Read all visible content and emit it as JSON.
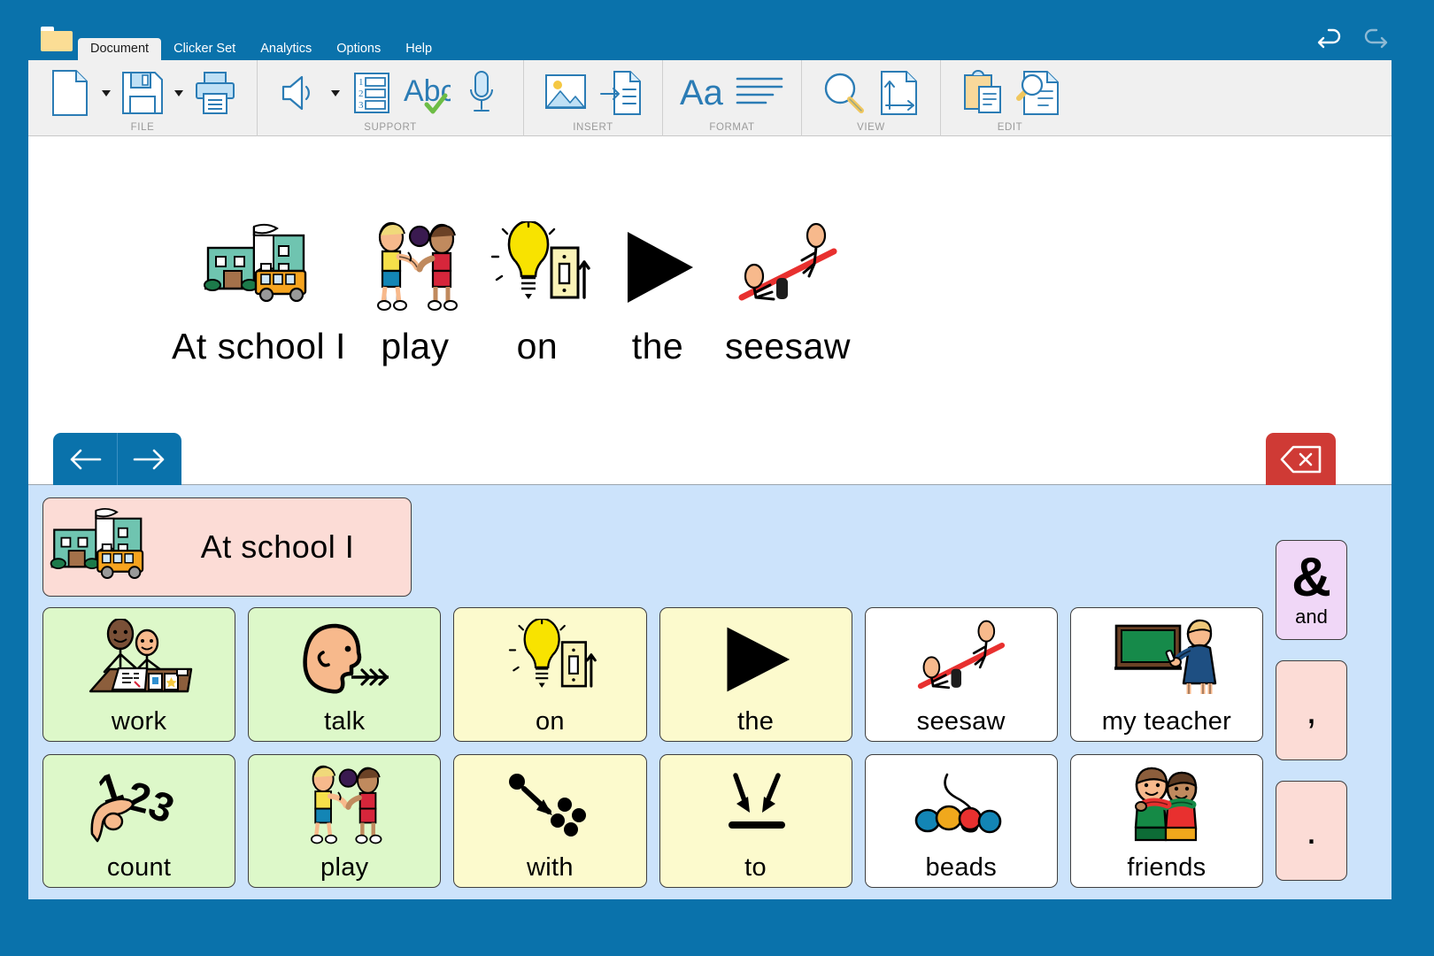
{
  "app": {
    "title_bar_color": "#0a72ab",
    "folder_icon": "folder-icon"
  },
  "tabs": [
    {
      "label": "Document",
      "active": true
    },
    {
      "label": "Clicker Set",
      "active": false
    },
    {
      "label": "Analytics",
      "active": false
    },
    {
      "label": "Options",
      "active": false
    },
    {
      "label": "Help",
      "active": false
    }
  ],
  "title_actions": {
    "undo": {
      "name": "undo-icon",
      "enabled": true,
      "color": "#ffffff"
    },
    "redo": {
      "name": "redo-icon",
      "enabled": false,
      "color": "#8db9d4"
    }
  },
  "ribbon": {
    "groups": [
      {
        "label": "FILE",
        "items": [
          {
            "name": "new-document-button",
            "icon": "new-document-icon",
            "caret": true
          },
          {
            "name": "save-button",
            "icon": "save-icon",
            "caret": true
          },
          {
            "name": "print-button",
            "icon": "print-icon",
            "caret": false
          }
        ]
      },
      {
        "label": "SUPPORT",
        "items": [
          {
            "name": "speak-button",
            "icon": "speaker-icon",
            "caret": true
          },
          {
            "name": "word-bank-button",
            "icon": "numbered-list-icon",
            "caret": false
          },
          {
            "name": "spell-check-button",
            "icon": "abc-check-icon",
            "caret": false
          },
          {
            "name": "record-button",
            "icon": "microphone-icon",
            "caret": false
          }
        ]
      },
      {
        "label": "INSERT",
        "items": [
          {
            "name": "insert-picture-button",
            "icon": "picture-icon",
            "caret": false
          },
          {
            "name": "insert-page-button",
            "icon": "insert-page-icon",
            "caret": false
          }
        ]
      },
      {
        "label": "FORMAT",
        "items": [
          {
            "name": "font-button",
            "icon": "font-aa-icon",
            "caret": false
          },
          {
            "name": "alignment-button",
            "icon": "align-lines-icon",
            "caret": false
          }
        ]
      },
      {
        "label": "VIEW",
        "items": [
          {
            "name": "zoom-button",
            "icon": "magnifier-icon",
            "caret": false
          },
          {
            "name": "page-size-button",
            "icon": "page-size-icon",
            "caret": false
          }
        ]
      },
      {
        "label": "EDIT",
        "items": [
          {
            "name": "paste-button",
            "icon": "clipboard-icon",
            "caret": false
          },
          {
            "name": "find-button",
            "icon": "find-document-icon",
            "caret": false
          }
        ]
      }
    ]
  },
  "document": {
    "sentence": [
      {
        "word": "At school I",
        "picture": "school-with-bus-icon"
      },
      {
        "word": "play",
        "picture": "two-children-ball-icon"
      },
      {
        "word": "on",
        "picture": "lightbulb-switch-on-icon"
      },
      {
        "word": "the",
        "picture": "black-triangle-icon"
      },
      {
        "word": "seesaw",
        "picture": "seesaw-icon"
      }
    ]
  },
  "navigation": {
    "back": {
      "name": "back-arrow-button",
      "icon": "arrow-left-icon"
    },
    "forward": {
      "name": "forward-arrow-button",
      "icon": "arrow-right-icon"
    },
    "delete": {
      "name": "delete-button",
      "icon": "backspace-icon",
      "color": "#cf3a35"
    }
  },
  "grid": {
    "background_color": "#cce3fb",
    "sentence_start": {
      "label": "At school I",
      "picture": "school-with-bus-icon",
      "color": "#fcdcd6"
    },
    "cells": [
      {
        "label": "work",
        "picture": "children-working-desk-icon",
        "color": "green"
      },
      {
        "label": "talk",
        "picture": "head-talking-icon",
        "color": "green"
      },
      {
        "label": "on",
        "picture": "lightbulb-switch-on-icon",
        "color": "yellow"
      },
      {
        "label": "the",
        "picture": "black-triangle-icon",
        "color": "yellow"
      },
      {
        "label": "seesaw",
        "picture": "seesaw-icon",
        "color": "white"
      },
      {
        "label": "my teacher",
        "picture": "teacher-blackboard-icon",
        "color": "white"
      },
      {
        "label": "count",
        "picture": "hand-counting-123-icon",
        "color": "green"
      },
      {
        "label": "play",
        "picture": "two-children-ball-icon",
        "color": "green"
      },
      {
        "label": "with",
        "picture": "arrow-to-dots-icon",
        "color": "yellow"
      },
      {
        "label": "to",
        "picture": "arrows-down-line-icon",
        "color": "yellow"
      },
      {
        "label": "beads",
        "picture": "beads-string-icon",
        "color": "white"
      },
      {
        "label": "friends",
        "picture": "two-friends-icon",
        "color": "white"
      }
    ],
    "punctuation": [
      {
        "glyph": "&",
        "label": "and",
        "color": "purple",
        "name": "punct-cell-and"
      },
      {
        "glyph": ",",
        "label": "",
        "color": "pink",
        "name": "punct-cell-comma"
      },
      {
        "glyph": ".",
        "label": "",
        "color": "pink",
        "name": "punct-cell-period"
      }
    ]
  }
}
